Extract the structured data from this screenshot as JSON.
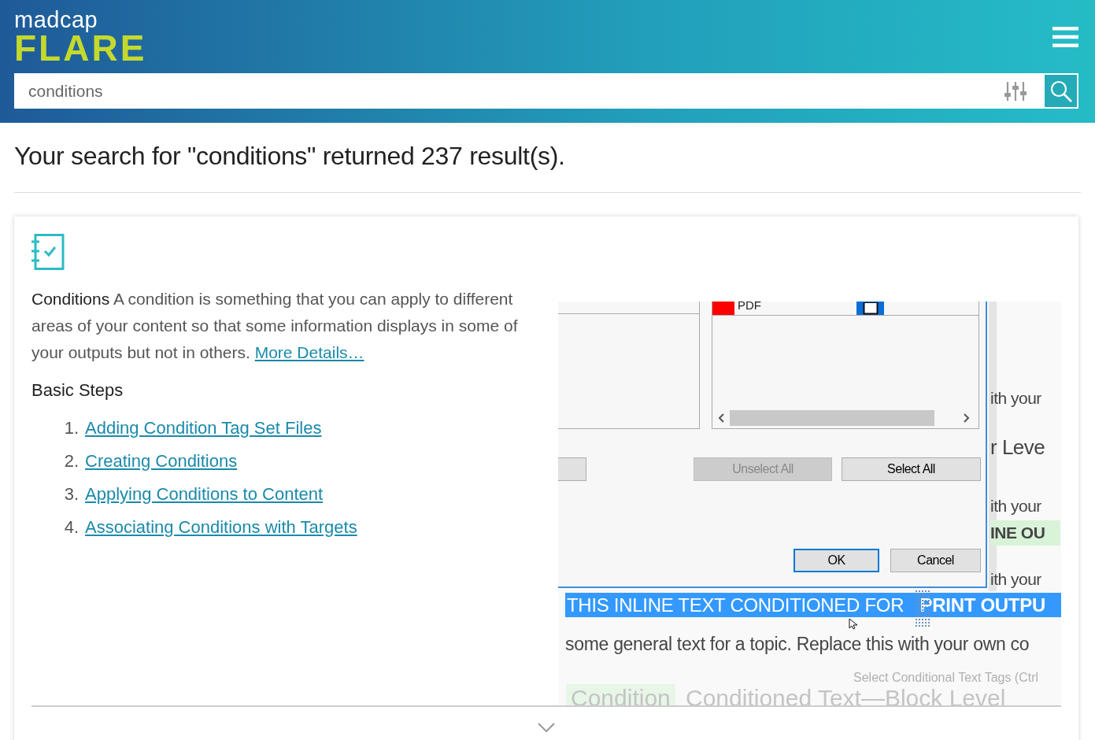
{
  "header": {
    "logo_top": "madcap",
    "logo_bottom": "FLARE",
    "search": {
      "value": "conditions"
    }
  },
  "results_summary": "Your search for \"conditions\" returned 237 result(s).",
  "results": [
    {
      "title": "Conditions",
      "description": "A condition is something that you can apply to different areas of your content so that some information displays in some of your outputs but not in others.",
      "more_link": "More Details…",
      "steps_heading": "Basic Steps",
      "steps": [
        {
          "number": "1.",
          "label": "Adding Condition Tag Set Files"
        },
        {
          "number": "2.",
          "label": "Creating Conditions"
        },
        {
          "number": "3.",
          "label": "Applying Conditions to Content"
        },
        {
          "number": "4.",
          "label": "Associating Conditions with Targets"
        }
      ],
      "screenshot": {
        "list_items": [
          {
            "label": "PDF",
            "color": "#ff0000",
            "checked": false
          }
        ],
        "buttons": [
          {
            "label": "Unselect All",
            "disabled": true
          },
          {
            "label": "Select All",
            "disabled": false
          }
        ],
        "dialog_buttons": [
          {
            "label": "OK",
            "default": true
          },
          {
            "label": "Cancel",
            "default": false
          }
        ],
        "background_lines": [
          {
            "kind": "text",
            "text": "ith your"
          },
          {
            "kind": "heading",
            "text": "r Leve"
          },
          {
            "kind": "text",
            "text": "ith your"
          },
          {
            "kind": "tagged",
            "text": "INE OU"
          },
          {
            "kind": "text",
            "text": "ith your"
          }
        ],
        "highlighted_text": "THIS INLINE TEXT CONDITIONED FOR **PRINT OUTPU**",
        "body_text": "some general text for a topic. Replace this with your own co",
        "tooltip": "Select Conditional Text Tags (Ctrl",
        "condition_tag": "Condition",
        "block_heading": "Conditioned Text—Block Level"
      }
    }
  ]
}
